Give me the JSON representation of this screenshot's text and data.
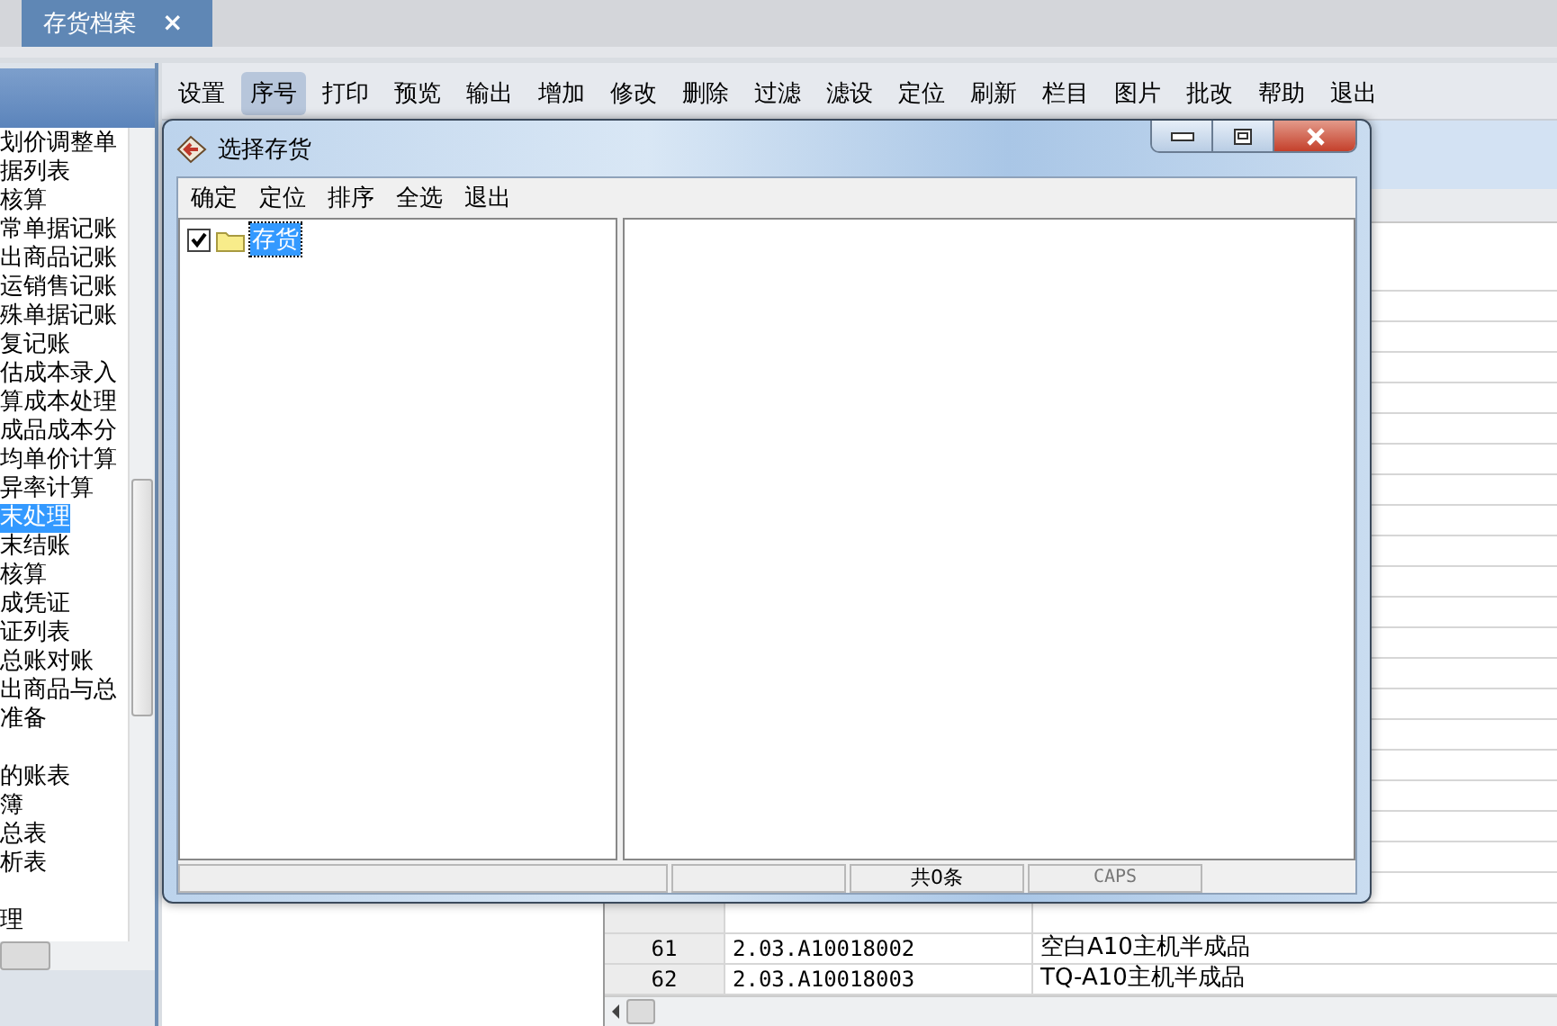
{
  "tabs": [
    {
      "label": "存货档案",
      "close": "×",
      "selected": true
    }
  ],
  "sidebar": {
    "items": [
      {
        "kind": "item",
        "label": "划价调整单",
        "selected": false
      },
      {
        "kind": "item",
        "label": "据列表",
        "selected": false
      },
      {
        "kind": "item",
        "label": "核算",
        "selected": false
      },
      {
        "kind": "item",
        "label": "常单据记账",
        "selected": false
      },
      {
        "kind": "item",
        "label": "出商品记账",
        "selected": false
      },
      {
        "kind": "item",
        "label": "运销售记账",
        "selected": false
      },
      {
        "kind": "item",
        "label": "殊单据记账",
        "selected": false
      },
      {
        "kind": "item",
        "label": "复记账",
        "selected": false
      },
      {
        "kind": "item",
        "label": "估成本录入",
        "selected": false
      },
      {
        "kind": "item",
        "label": "算成本处理",
        "selected": false
      },
      {
        "kind": "item",
        "label": "成品成本分",
        "selected": false
      },
      {
        "kind": "item",
        "label": "均单价计算",
        "selected": false
      },
      {
        "kind": "item",
        "label": "异率计算",
        "selected": false
      },
      {
        "kind": "item",
        "label": "末处理",
        "selected": true
      },
      {
        "kind": "item",
        "label": "末结账",
        "selected": false
      },
      {
        "kind": "item",
        "label": "核算",
        "selected": false
      },
      {
        "kind": "item",
        "label": "成凭证",
        "selected": false
      },
      {
        "kind": "item",
        "label": "证列表",
        "selected": false
      },
      {
        "kind": "item",
        "label": "总账对账",
        "selected": false
      },
      {
        "kind": "item",
        "label": "出商品与总",
        "selected": false
      },
      {
        "kind": "item",
        "label": "准备",
        "selected": false
      },
      {
        "kind": "blank"
      },
      {
        "kind": "item",
        "label": "的账表",
        "selected": false
      },
      {
        "kind": "item",
        "label": "簿",
        "selected": false
      },
      {
        "kind": "item",
        "label": "总表",
        "selected": false
      },
      {
        "kind": "item",
        "label": "析表",
        "selected": false
      },
      {
        "kind": "blank"
      },
      {
        "kind": "item",
        "label": "理",
        "selected": false
      }
    ]
  },
  "toolbar": [
    {
      "label": "设置",
      "selected": false
    },
    {
      "label": "序号",
      "selected": true
    },
    {
      "label": "打印",
      "selected": false
    },
    {
      "label": "预览",
      "selected": false
    },
    {
      "label": "输出",
      "selected": false
    },
    {
      "label": "增加",
      "selected": false
    },
    {
      "label": "修改",
      "selected": false
    },
    {
      "label": "删除",
      "selected": false
    },
    {
      "label": "过滤",
      "selected": false
    },
    {
      "label": "滤设",
      "selected": false
    },
    {
      "label": "定位",
      "selected": false
    },
    {
      "label": "刷新",
      "selected": false
    },
    {
      "label": "栏目",
      "selected": false
    },
    {
      "label": "图片",
      "selected": false
    },
    {
      "label": "批改",
      "selected": false
    },
    {
      "label": "帮助",
      "selected": false
    },
    {
      "label": "退出",
      "selected": false
    }
  ],
  "table": {
    "rows": [
      {
        "cells": [
          "61",
          "2.03.A10018002",
          "空白A10主机半成品"
        ]
      },
      {
        "cells": [
          "62",
          "2.03.A10018003",
          "TQ-A10主机半成品"
        ]
      }
    ]
  },
  "dialog": {
    "title": "选择存货",
    "toolbar": [
      "确定",
      "定位",
      "排序",
      "全选",
      "退出"
    ],
    "tree": [
      {
        "label": "存货",
        "checked": true,
        "selected": true
      }
    ],
    "status_bar": [
      "共0条",
      "CAPS"
    ]
  }
}
